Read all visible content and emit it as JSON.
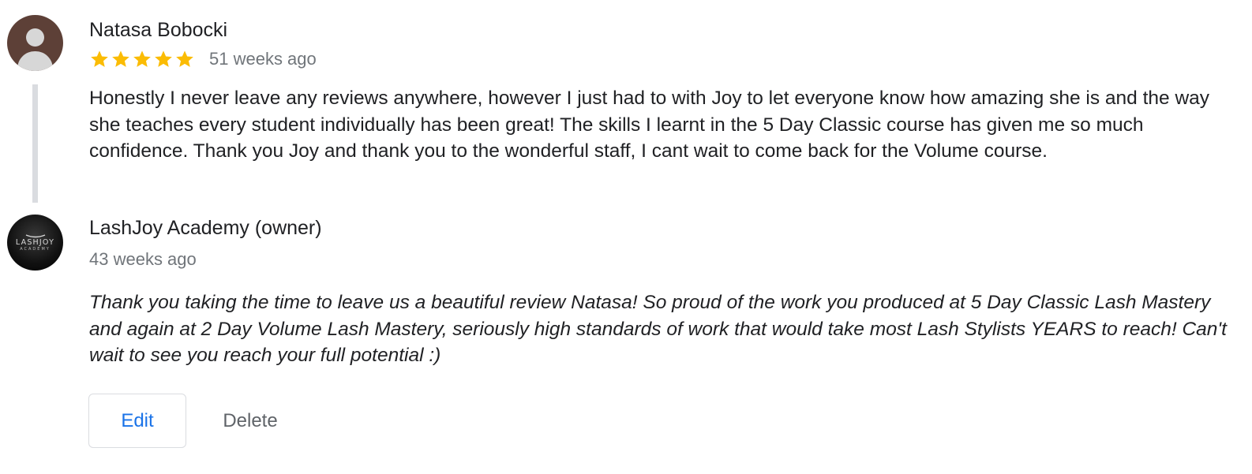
{
  "review": {
    "author": "Natasa Bobocki",
    "rating": 5,
    "rating_max": 5,
    "time": "51 weeks ago",
    "text": "Honestly I never leave any reviews anywhere, however I just had to with Joy to let everyone know how amazing she is and the way she teaches every student individually has been great! The skills I learnt in the 5 Day Classic course has given me so much confidence. Thank you Joy and thank you to the wonderful staff, I cant wait to come back for the Volume course.",
    "avatar_icon": "person-silhouette-icon",
    "avatar_color": "#5d4037",
    "star_color": "#fbbc04"
  },
  "owner_response": {
    "name": "LashJoy Academy (owner)",
    "time": "43 weeks ago",
    "text": "Thank you taking the time to leave us a beautiful review Natasa! So proud of the work you produced at 5 Day Classic Lash Mastery and again at 2 Day Volume Lash Mastery, seriously high standards of work that would take most Lash Stylists YEARS to reach! Can't wait to see you reach your full potential :)",
    "logo": {
      "main": "LASHJOY",
      "sub": "ACADEMY"
    }
  },
  "actions": {
    "edit_label": "Edit",
    "delete_label": "Delete",
    "edit_color": "#1a73e8"
  }
}
